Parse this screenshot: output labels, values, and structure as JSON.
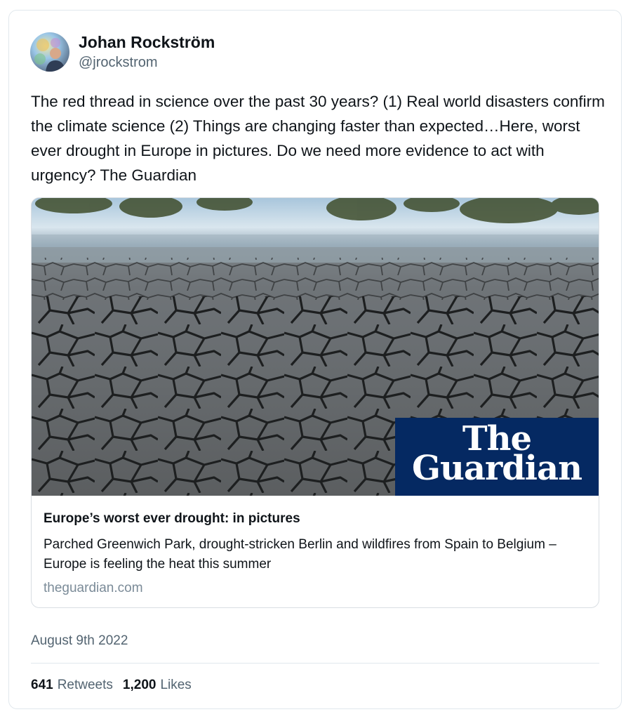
{
  "author": {
    "name": "Johan Rockström",
    "handle": "@jrockstrom"
  },
  "tweet": {
    "text": "The red thread in science over the past 30 years? (1) Real world disasters confirm the climate science (2) Things are changing faster than expected…Here, worst ever drought in Europe in pictures. Do we need more evidence to act with urgency? The Guardian",
    "date": "August 9th 2022"
  },
  "link_card": {
    "brand_line1": "The",
    "brand_line2": "Guardian",
    "title": "Europe’s worst ever drought: in pictures",
    "description": "Parched Greenwich Park, drought-stricken Berlin and wildfires from Spain to Belgium – Europe is feeling the heat this summer",
    "domain": "theguardian.com"
  },
  "stats": {
    "retweets_count": "641",
    "retweets_label": "Retweets",
    "likes_count": "1,200",
    "likes_label": "Likes"
  },
  "colors": {
    "brand_navy": "#052962",
    "secondary_text": "#536471"
  }
}
